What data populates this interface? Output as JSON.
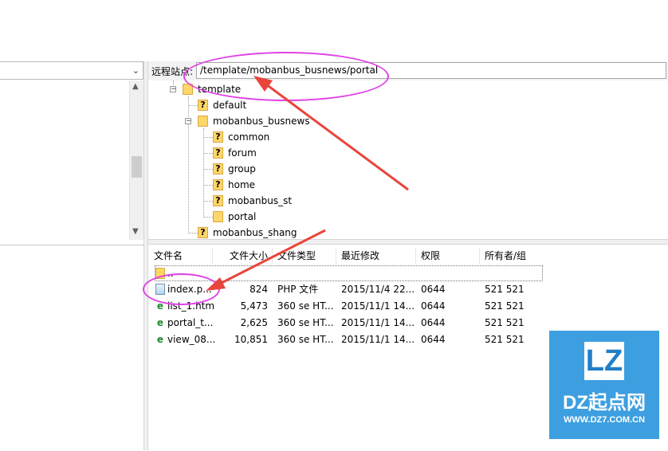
{
  "remote_site": {
    "label": "远程站点:",
    "path": "/template/mobanbus_busnews/portal"
  },
  "tree": [
    {
      "name": "template",
      "icon": "folder-icon"
    },
    {
      "name": "default",
      "icon": "unknown-folder-icon"
    },
    {
      "name": "mobanbus_busnews",
      "icon": "folder-icon"
    },
    {
      "name": "common",
      "icon": "unknown-folder-icon"
    },
    {
      "name": "forum",
      "icon": "unknown-folder-icon"
    },
    {
      "name": "group",
      "icon": "unknown-folder-icon"
    },
    {
      "name": "home",
      "icon": "unknown-folder-icon"
    },
    {
      "name": "mobanbus_st",
      "icon": "unknown-folder-icon"
    },
    {
      "name": "portal",
      "icon": "folder-icon"
    },
    {
      "name": "mobanbus_shang",
      "icon": "unknown-folder-icon"
    }
  ],
  "file_list": {
    "columns": [
      "文件名",
      "文件大小",
      "文件类型",
      "最近修改",
      "权限",
      "所有者/组"
    ],
    "parent_entry": "..",
    "rows": [
      {
        "name": "index.p...",
        "size": "824",
        "type": "PHP 文件",
        "modified": "2015/11/4 22...",
        "perms": "0644",
        "owner": "521 521",
        "icon": "php-file-icon"
      },
      {
        "name": "list_1.htm",
        "size": "5,473",
        "type": "360 se HT...",
        "modified": "2015/11/1 14...",
        "perms": "0644",
        "owner": "521 521",
        "icon": "html-file-icon"
      },
      {
        "name": "portal_t...",
        "size": "2,625",
        "type": "360 se HT...",
        "modified": "2015/11/1 14...",
        "perms": "0644",
        "owner": "521 521",
        "icon": "html-file-icon"
      },
      {
        "name": "view_08...",
        "size": "10,851",
        "type": "360 se HT...",
        "modified": "2015/11/1 14...",
        "perms": "0644",
        "owner": "521 521",
        "icon": "html-file-icon"
      }
    ]
  },
  "watermark": {
    "logo": "LZ",
    "name": "DZ起点网",
    "url": "WWW.DZ7.COM.CN"
  },
  "colors": {
    "annotation": "#e040e6",
    "arrow": "#e8453c",
    "watermark_bg": "#3d9fe0",
    "folder": "#ffd668"
  }
}
